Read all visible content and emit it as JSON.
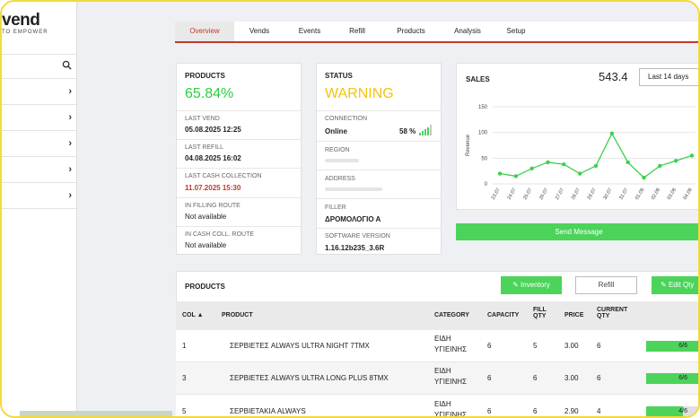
{
  "app": {
    "logo_text": "vend",
    "tagline": "TO EMPOWER"
  },
  "sidebar": {
    "search_icon": "search-icon",
    "chevron": "›",
    "items": [
      {
        "label": ""
      },
      {
        "label": ""
      },
      {
        "label": ""
      },
      {
        "label": ""
      },
      {
        "label": ""
      }
    ]
  },
  "tabs": [
    {
      "label": "Overview",
      "active": true
    },
    {
      "label": "Vends"
    },
    {
      "label": "Events"
    },
    {
      "label": "Refill"
    },
    {
      "label": "Products"
    },
    {
      "label": "Analysis"
    },
    {
      "label": "Setup"
    }
  ],
  "products_card": {
    "title": "PRODUCTS",
    "percent": "65.84%",
    "last_vend_label": "LAST VEND",
    "last_vend": "05.08.2025 12:25",
    "last_refill_label": "LAST REFILL",
    "last_refill": "04.08.2025 16:02",
    "last_cash_label": "LAST CASH COLLECTION",
    "last_cash": "11.07.2025 15:30",
    "filling_route_label": "IN FILLING ROUTE",
    "filling_route": "Not available",
    "cash_route_label": "IN CASH COLL. ROUTE",
    "cash_route": "Not available"
  },
  "status_card": {
    "title": "STATUS",
    "status": "WARNING",
    "connection_label": "CONNECTION",
    "connection": "Online",
    "signal": "58 %",
    "signal_icon": "signal-bars-icon",
    "region_label": "REGION",
    "address_label": "ADDRESS",
    "filler_label": "FILLER",
    "filler": "ΔΡΟΜΟΛΟΓΙΟ Α",
    "software_label": "SOFTWARE VERSION",
    "software": "1.16.12b235_3.6R"
  },
  "sales_card": {
    "title": "SALES",
    "total": "543.4",
    "range": "Last 14 days",
    "send_message": "Send Message"
  },
  "chart_data": {
    "type": "line",
    "title": "",
    "ylabel": "Revenue",
    "xlabel": "",
    "ylim": [
      0,
      150
    ],
    "yticks": [
      0,
      50,
      100,
      150
    ],
    "x": [
      "23.07",
      "24.07",
      "25.07",
      "26.07",
      "27.07",
      "28.07",
      "29.07",
      "30.07",
      "31.07",
      "01.08",
      "02.08",
      "03.08",
      "04.08"
    ],
    "values": [
      20,
      15,
      30,
      42,
      38,
      20,
      35,
      98,
      42,
      12,
      35,
      45,
      55
    ],
    "color": "#3ecf4d",
    "grid": true
  },
  "products_table": {
    "title": "PRODUCTS",
    "inventory_btn": "Inventory",
    "refill_btn": "Refill",
    "edit_btn": "Edit Qty",
    "inventory_icon": "edit-icon",
    "headers": {
      "col": "COL ▲",
      "product": "PRODUCT",
      "category": "CATEGORY",
      "capacity": "CAPACITY",
      "fill_qty": "FILL QTY",
      "price": "PRICE",
      "current_qty": "CURRENT QTY"
    },
    "rows": [
      {
        "col": "1",
        "product": "ΣΕΡΒΙΕΤΕΣ ALWAYS ULTRA NIGHT 7TMX",
        "category": "ΕΙΔΗ ΥΓΙΕΙΝΗΣ",
        "capacity": "6",
        "fill": "5",
        "price": "3.00",
        "current": "6",
        "bar": "6/6",
        "ratio": 1.0
      },
      {
        "col": "3",
        "product": "ΣΕΡΒΙΕΤΕΣ ALWAYS ULTRA LONG PLUS 8TMX",
        "category": "ΕΙΔΗ ΥΓΙΕΙΝΗΣ",
        "capacity": "6",
        "fill": "6",
        "price": "3.00",
        "current": "6",
        "bar": "6/6",
        "ratio": 1.0
      },
      {
        "col": "5",
        "product": "ΣΕΡΒΙΕΤΑΚΙΑ ALWAYS",
        "category": "ΕΙΔΗ ΥΓΙΕΙΝΗΣ",
        "capacity": "6",
        "fill": "6",
        "price": "2.90",
        "current": "4",
        "bar": "4/6",
        "ratio": 0.667
      }
    ]
  }
}
